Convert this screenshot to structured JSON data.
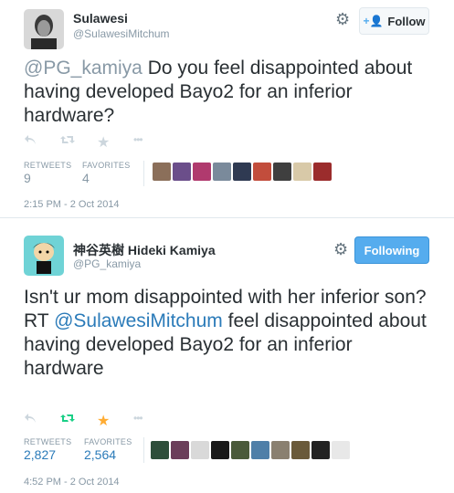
{
  "tweets": [
    {
      "name": "Sulawesi",
      "handle": "@SulawesiMitchum",
      "follow_label": "Follow",
      "mention": "@PG_kamiya",
      "body": " Do you feel disappointed about having developed Bayo2 for an inferior hardware?",
      "retweets_label": "RETWEETS",
      "retweets_value": "9",
      "favorites_label": "FAVORITES",
      "favorites_value": "4",
      "timestamp": "2:15 PM - 2 Oct 2014"
    },
    {
      "name": "神谷英樹 Hideki Kamiya",
      "handle": "@PG_kamiya",
      "follow_label": "Following",
      "body_line1": "Isn't ur mom disappointed with her inferior son?",
      "rt_prefix": "RT ",
      "mention": "@SulawesiMitchum",
      "body_rest": " feel disappointed about having developed Bayo2 for an inferior hardware",
      "retweets_label": "RETWEETS",
      "retweets_value": "2,827",
      "favorites_label": "FAVORITES",
      "favorites_value": "2,564",
      "timestamp": "4:52 PM - 2 Oct 2014"
    }
  ],
  "icons": {
    "reply": "reply-icon",
    "retweet": "retweet-icon",
    "favorite": "star-icon",
    "more": "more-icon",
    "settings": "gear-icon"
  },
  "colors": {
    "link_blue": "#2b7bb9",
    "follow_blue": "#55acee",
    "retweet_green": "#19cf86",
    "favorite_gold": "#ffac33",
    "muted": "#8899a6"
  }
}
